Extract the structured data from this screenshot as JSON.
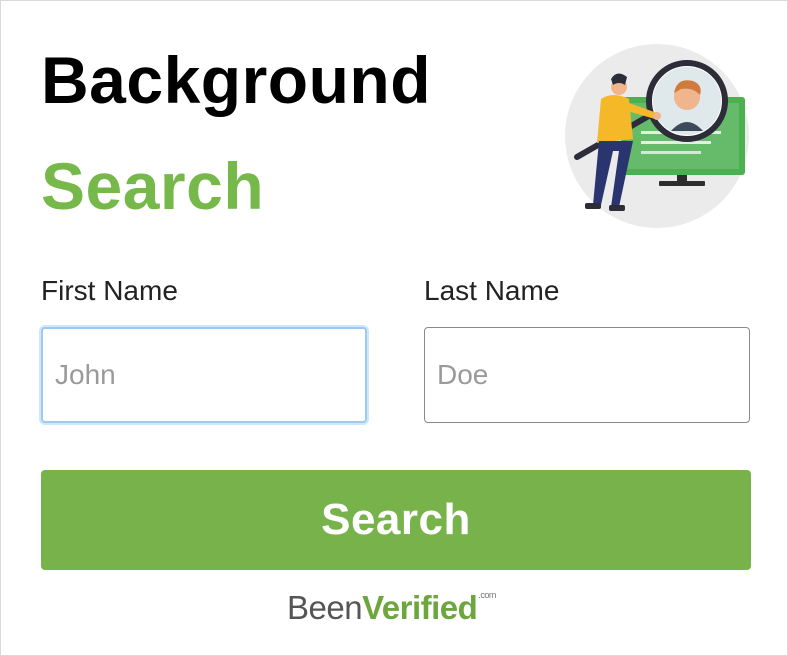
{
  "widget": {
    "title_line1": "Background",
    "title_line2": "Search",
    "illustration": "person-with-magnifier-illustration"
  },
  "form": {
    "first_name": {
      "label": "First Name",
      "placeholder": "John",
      "value": ""
    },
    "last_name": {
      "label": "Last Name",
      "placeholder": "Doe",
      "value": ""
    },
    "submit_label": "Search"
  },
  "footer": {
    "brand_part1": "Been",
    "brand_part2": "Verified",
    "brand_suffix": ".com"
  },
  "colors": {
    "accent_green": "#77b34a",
    "focus_blue": "#9ccaf3"
  }
}
